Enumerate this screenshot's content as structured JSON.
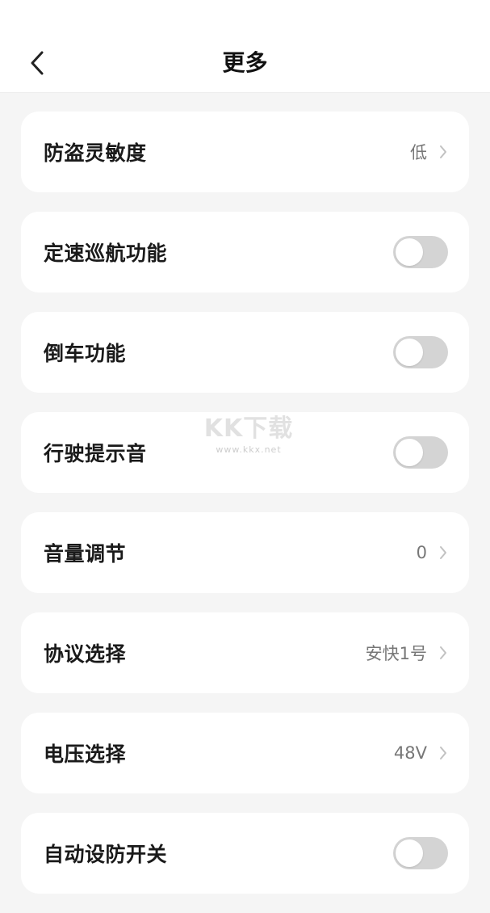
{
  "header": {
    "title": "更多",
    "back_icon": "chevron-left-icon"
  },
  "settings": [
    {
      "label": "防盗灵敏度",
      "type": "value",
      "value": "低"
    },
    {
      "label": "定速巡航功能",
      "type": "toggle",
      "on": false
    },
    {
      "label": "倒车功能",
      "type": "toggle",
      "on": false
    },
    {
      "label": "行驶提示音",
      "type": "toggle",
      "on": false
    },
    {
      "label": "音量调节",
      "type": "value",
      "value": "0"
    },
    {
      "label": "协议选择",
      "type": "value",
      "value": "安快1号"
    },
    {
      "label": "电压选择",
      "type": "value",
      "value": "48V"
    },
    {
      "label": "自动设防开关",
      "type": "toggle",
      "on": false
    }
  ],
  "watermark": {
    "title": "KK下载",
    "url": "www.kkx.net"
  },
  "colors": {
    "background": "#f5f5f5",
    "card": "#ffffff",
    "toggle_off": "#d4d4d4",
    "value_text": "#777777"
  }
}
